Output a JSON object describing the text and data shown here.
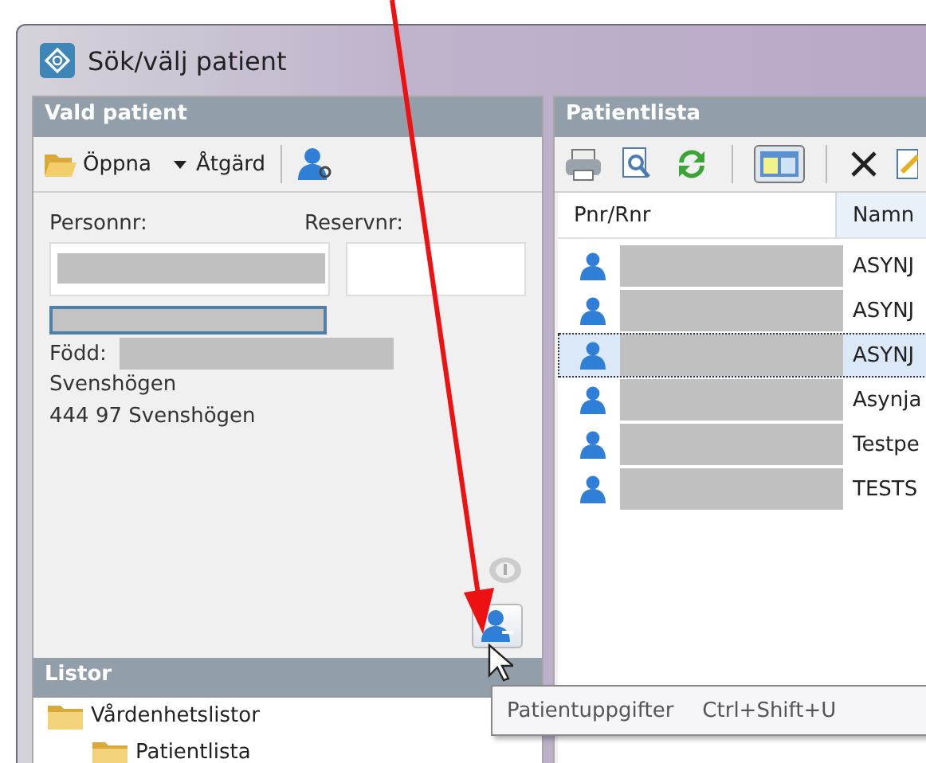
{
  "window": {
    "title": "Sök/välj patient"
  },
  "selected_patient": {
    "title": "Vald patient",
    "open_label": "Öppna",
    "action_label": "Åtgärd",
    "personnr_label": "Personnr:",
    "reservnr_label": "Reservnr:",
    "born_label": "Född:",
    "address": [
      "Svenshögen",
      "444 97 Svenshögen"
    ]
  },
  "patient_list": {
    "title": "Patientlista",
    "columns": [
      "Pnr/Rnr",
      "Namn"
    ],
    "rows": [
      {
        "name": "ASYNJ",
        "selected": false
      },
      {
        "name": "ASYNJ",
        "selected": false
      },
      {
        "name": "ASYNJ",
        "selected": true
      },
      {
        "name": "Asynja",
        "selected": false
      },
      {
        "name": "Testpe",
        "selected": false
      },
      {
        "name": "TESTS",
        "selected": false
      }
    ]
  },
  "lists": {
    "title": "Listor",
    "tree": [
      {
        "label": "Vårdenhetslistor",
        "children": [
          {
            "label": "Patientlista"
          }
        ]
      }
    ]
  },
  "tooltip": {
    "label": "Patientuppgifter",
    "shortcut": "Ctrl+Shift+U"
  }
}
